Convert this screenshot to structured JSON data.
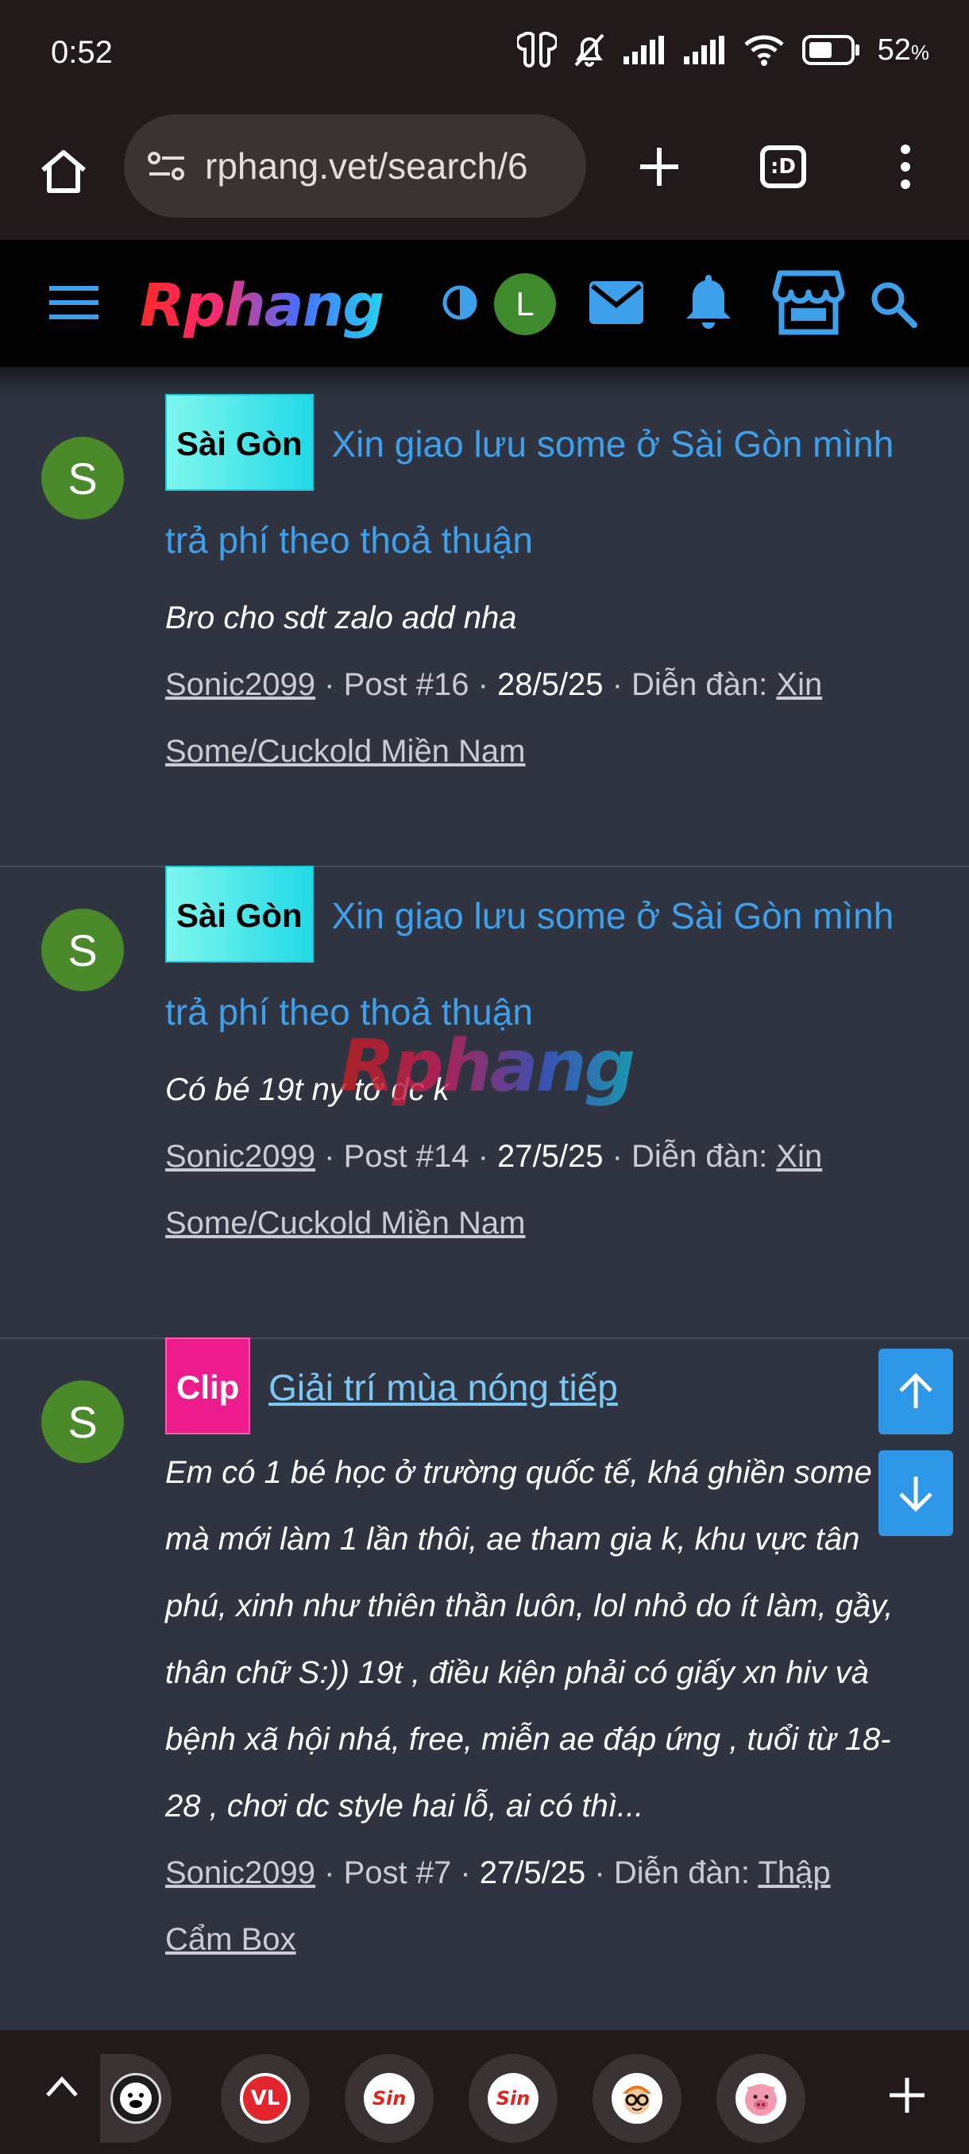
{
  "status_bar": {
    "time": "0:52",
    "battery": "52",
    "battery_unit": "%"
  },
  "browser": {
    "url": "rphang.vet/search/6"
  },
  "site": {
    "logo": "Rphang",
    "user_initial": "L",
    "watermark": "Rphang"
  },
  "results": [
    {
      "avatar": "S",
      "prefix": "Sài Gòn",
      "title_1": "Xin giao lưu some ở Sài Gòn mình",
      "title_2": "trả phí theo thoả thuận",
      "snippet": "Bro cho sdt zalo add nha",
      "author": "Sonic2099",
      "post": "Post #16",
      "date": "28/5/25",
      "forum_label": "Diễn đàn:",
      "forum_1": "Xin",
      "forum_2": "Some/Cuckold Miền Nam"
    },
    {
      "avatar": "S",
      "prefix": "Sài Gòn",
      "title_1": "Xin giao lưu some ở Sài Gòn mình",
      "title_2": "trả phí theo thoả thuận",
      "snippet": "Có bé 19t ny tớ dc k",
      "author": "Sonic2099",
      "post": "Post #14",
      "date": "27/5/25",
      "forum_label": "Diễn đàn:",
      "forum_1": "Xin",
      "forum_2": "Some/Cuckold Miền Nam"
    },
    {
      "avatar": "S",
      "prefix": "Clip",
      "title_1": "Giải trí mùa nóng tiếp",
      "snippet_lines": [
        "Em có 1 bé học ở trường quốc tế, khá ghiền some",
        "mà mới làm 1 lần thôi, ae tham gia k, khu vực tân",
        "phú, xinh như thiên thần luôn, lol nhỏ do ít làm, gầy,",
        "thân chữ S:)) 19t , điều kiện phải có giấy xn hiv và",
        "bệnh xã hội nhá, free, miễn ae đáp ứng , tuổi từ 18-",
        "28 , chơi dc style hai lỗ, ai có thì..."
      ],
      "author": "Sonic2099",
      "post": "Post #7",
      "date": "27/5/25",
      "forum_label": "Diễn đàn:",
      "forum_1": "Thập",
      "forum_2": "Cẩm Box"
    }
  ],
  "tab_strip": {
    "favicons": [
      "pig-mask",
      "VL",
      "Sin",
      "Sin",
      "nerd-face",
      "pig"
    ],
    "vl_label": "VL",
    "sin_label": "Sin"
  },
  "colors": {
    "link": "#3ea0ea",
    "prefix_saigon": "#21d9e6",
    "prefix_clip": "#ec1c8c",
    "scroll_button": "#2e97e8",
    "avatar": "#4a8a2b"
  }
}
